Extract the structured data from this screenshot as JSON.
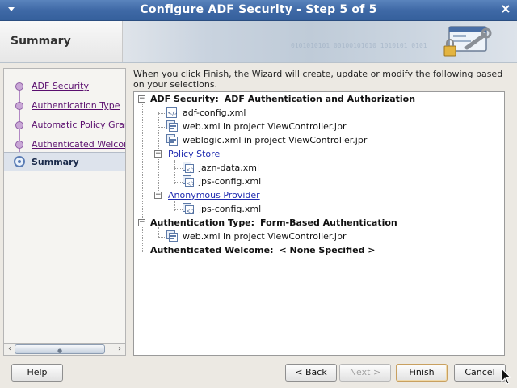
{
  "window": {
    "title": "Configure ADF Security - Step 5 of 5",
    "menu_icon": "window-menu-icon",
    "close_icon": "close-icon"
  },
  "header": {
    "title": "Summary",
    "binary_text": "0101010101 00100101010 1010101 0101",
    "icon": "security-wizard-icon"
  },
  "nav": {
    "items": [
      {
        "label": "ADF Security",
        "current": false
      },
      {
        "label": "Authentication Type",
        "current": false
      },
      {
        "label": "Automatic Policy Grant",
        "current": false
      },
      {
        "label": "Authenticated Welcome",
        "current": false
      },
      {
        "label": "Summary",
        "current": true
      }
    ]
  },
  "description": "When you click Finish, the Wizard will create, update or modify the following based on your selections.",
  "tree": {
    "adf_security": {
      "label": "ADF Security:",
      "value": "ADF Authentication and Authorization"
    },
    "adf_config": "adf-config.xml",
    "web_xml": "web.xml in project ViewController.jpr",
    "weblogic_xml": "weblogic.xml in project ViewController.jpr",
    "policy_store": "Policy Store",
    "jazn_data": "jazn-data.xml",
    "jps_config_1": "jps-config.xml",
    "anonymous_provider": "Anonymous Provider",
    "jps_config_2": "jps-config.xml",
    "auth_type": {
      "label": "Authentication Type:",
      "value": "Form-Based Authentication"
    },
    "web_xml_2": "web.xml in project ViewController.jpr",
    "auth_welcome": {
      "label": "Authenticated Welcome:",
      "value": "< None Specified >"
    }
  },
  "buttons": {
    "help": {
      "label": "Help",
      "mnemonic": "H"
    },
    "back": {
      "label": "< Back",
      "mnemonic": "B"
    },
    "next": {
      "label": "Next >",
      "mnemonic": "N"
    },
    "finish": {
      "label": "Finish",
      "mnemonic": "F"
    },
    "cancel": {
      "label": "Cancel"
    }
  },
  "colors": {
    "titlebar": "#3f69a6",
    "link": "#1f2bb0",
    "visited_link": "#5a0e6e",
    "nav_dot": "#c9a7d6"
  }
}
